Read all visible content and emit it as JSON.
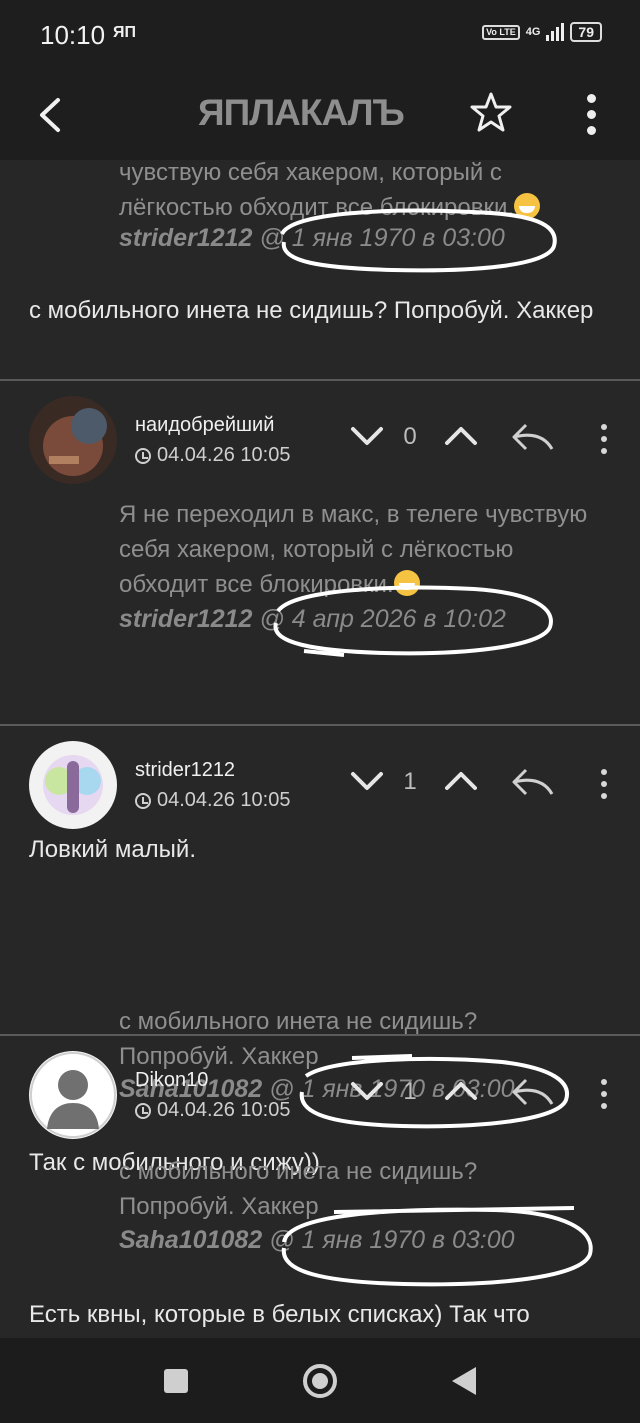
{
  "status_bar": {
    "time": "10:10",
    "left_icon": "ЯП",
    "volte": "Vo LTE",
    "network": "4G",
    "battery": "79"
  },
  "app_bar": {
    "logo": "ЯПЛАКАЛЪ",
    "icons": [
      "back-arrow-icon",
      "star-icon",
      "kebab-menu-icon"
    ]
  },
  "comments": [
    {
      "quote_text": "чувствую себя хакером, который с лёгкостью обходит все блокировки.",
      "quote_author": "strider1212",
      "quote_date": "1 янв 1970 в 03:00",
      "body": "с мобильного инета не сидишь? Попробуй. Хаккер"
    },
    {
      "author": "наидобрейший",
      "date": "04.04.26 10:05",
      "votes": "0",
      "quote_text": "Я не переходил в макс, в телеге чувствую себя хакером, который с лёгкостью обходит все блокировки.",
      "quote_author": "strider1212",
      "quote_date": "4 апр 2026 в 10:02",
      "body": "Ловкий малый."
    },
    {
      "author": "strider1212",
      "date": "04.04.26 10:05",
      "votes": "1",
      "quote_text": "с мобильного инета не сидишь? Попробуй. Хаккер",
      "quote_author": "Saha101082",
      "quote_date": "1 янв 1970 в 03:00",
      "body": "Так с мобильного и сижу))"
    },
    {
      "author": "Dikon10",
      "date": "04.04.26 10:05",
      "votes": "1",
      "quote_text": "с мобильного инета не сидишь? Попробуй. Хаккер",
      "quote_author": "Saha101082",
      "quote_date": "1 янв 1970 в 03:00",
      "body": "Есть квны, которые в белых списках) Так что"
    }
  ],
  "nav_bar": {
    "icons": [
      "recents-square-icon",
      "home-circle-icon",
      "back-triangle-icon"
    ]
  }
}
